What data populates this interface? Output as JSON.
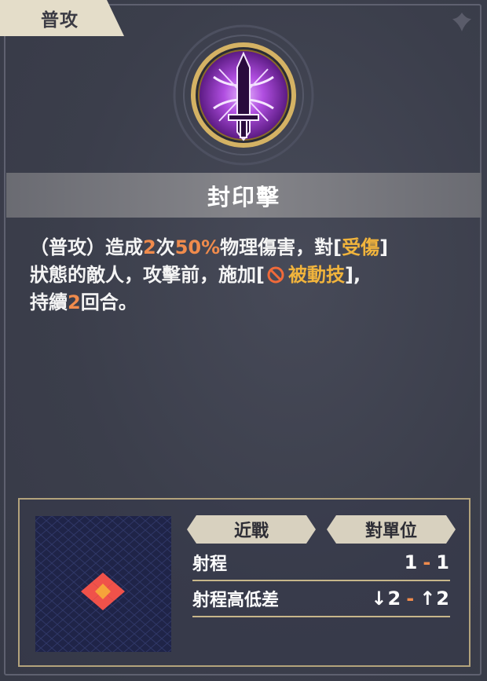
{
  "tag": {
    "label": "普攻"
  },
  "skill": {
    "name": "封印擊",
    "icon": "sealed-sword-icon"
  },
  "description": {
    "part1": "（普攻）造成",
    "hits": "2",
    "part2": "次",
    "percent": "50%",
    "part3": "物理傷害，對[",
    "status": "受傷",
    "part4": "]",
    "part5": "狀態的敵人，攻擊前，施加[",
    "effect": "被動技",
    "effect_icon": "prohibited-icon",
    "part6": "],",
    "part7": "持續",
    "turns": "2",
    "part8": "回合。"
  },
  "info": {
    "type_badge": "近戰",
    "target_badge": "對單位",
    "range_label": "射程",
    "range_min": "1",
    "range_max": "1",
    "height_label": "射程高低差",
    "height_down": "2",
    "height_up": "2",
    "range_dash": "-",
    "height_dash": "-"
  },
  "colors": {
    "highlight_orange": "#f08b4c",
    "highlight_gold": "#f1b43c",
    "tile_red": "#f0524a",
    "tile_orange": "#f6a43a"
  }
}
